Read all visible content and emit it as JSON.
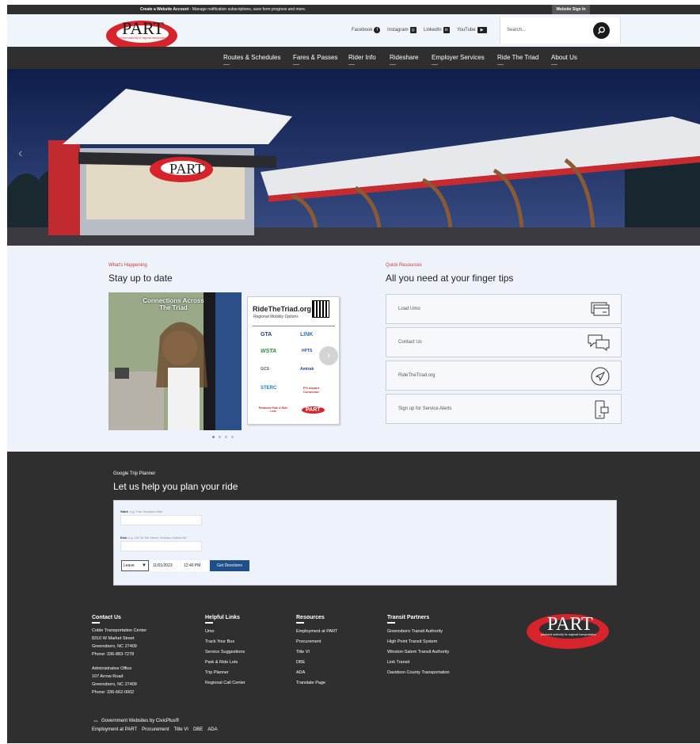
{
  "topbar": {
    "create_account": "Create a Website Account",
    "create_account_desc": " - Manage notification subscriptions, save form progress and more.",
    "sign_in": "Website Sign In"
  },
  "logo": {
    "text": "PART",
    "tagline": "piedmont authority for regional transportation"
  },
  "social": [
    {
      "label": "Facebook",
      "icon": "facebook-icon"
    },
    {
      "label": "Instagram",
      "icon": "instagram-icon"
    },
    {
      "label": "LinkedIn",
      "icon": "linkedin-icon"
    },
    {
      "label": "YouTube",
      "icon": "youtube-icon"
    }
  ],
  "search": {
    "placeholder": "Search..."
  },
  "nav": [
    "Routes & Schedules",
    "Fares & Passes",
    "Rider Info",
    "Rideshare",
    "Employer Services",
    "Ride The Triad",
    "About Us"
  ],
  "whats_happening": {
    "kicker": "What's Happening",
    "heading": "Stay up to date",
    "card1_title_line1": "Connections Across",
    "card1_title_line2": "The Triad",
    "card2": {
      "title": "RideTheTriad.org",
      "subtitle": "Regional Mobility Options",
      "agencies": [
        "GTA",
        "LINK",
        "WSTA",
        "HPTS",
        "GCS",
        "Amtrak",
        "STERC",
        "PTI Airport Connector",
        "Piedmont Park & Ride Lots",
        "PART"
      ]
    }
  },
  "quick_resources": {
    "kicker": "Quick Resources",
    "heading": "All you need at your finger tips",
    "items": [
      {
        "label": "Load Umo",
        "icon": "payment-card-icon"
      },
      {
        "label": "Contact Us",
        "icon": "chat-bubbles-icon"
      },
      {
        "label": "RideTheTriad.org",
        "icon": "navigation-arrow-icon"
      },
      {
        "label": "Sign up for Service Alerts",
        "icon": "mobile-phone-icon"
      }
    ]
  },
  "trip_planner": {
    "kicker": "Google Trip Planner",
    "heading": "Let us help you plan your ride",
    "start_label": "Start:",
    "start_hint": "e.g. Four Seasons Mall",
    "end_label": "End:",
    "end_hint": "e.g. 100 W 5th Street, Winston-Salem NC",
    "mode": "Leave",
    "date": "11/01/2023",
    "time": "12:40 PM",
    "button": "Get Directions"
  },
  "footer": {
    "contact": {
      "heading": "Contact Us",
      "lines": [
        "Coble Transportation Center",
        "8310 W Market Street",
        "Greensboro, NC 27409",
        "Phone: 336-883-7278"
      ],
      "lines2": [
        "Administrative Office",
        "107 Arrow Road",
        "Greensboro, NC 27409",
        "Phone: 336-662-0002"
      ]
    },
    "helpful": {
      "heading": "Helpful Links",
      "links": [
        "Umo",
        "Track Your Bus",
        "Service Suggestions",
        "Park & Ride Lots",
        "Trip Planner",
        "Regional Call Center"
      ]
    },
    "resources": {
      "heading": "Resources",
      "links": [
        "Employment at PART",
        "Procurement",
        "Title VI",
        "DBE",
        "ADA",
        "Translate Page"
      ]
    },
    "partners": {
      "heading": "Transit Partners",
      "links": [
        "Greensboro Transit Authority",
        "High Point Transit System",
        "Winston-Salem Transit Authority",
        "Link Transit",
        "Davidson County Transportation"
      ]
    },
    "civic": "Government Websites by CivicPlus®",
    "bottom_links": [
      "Employment at PART",
      "Procurement",
      "Title VI",
      "DBE",
      "ADA"
    ]
  },
  "colors": {
    "brand_red": "#d7232c",
    "dark": "#2f2f2f",
    "button_blue": "#1f4e8c"
  }
}
